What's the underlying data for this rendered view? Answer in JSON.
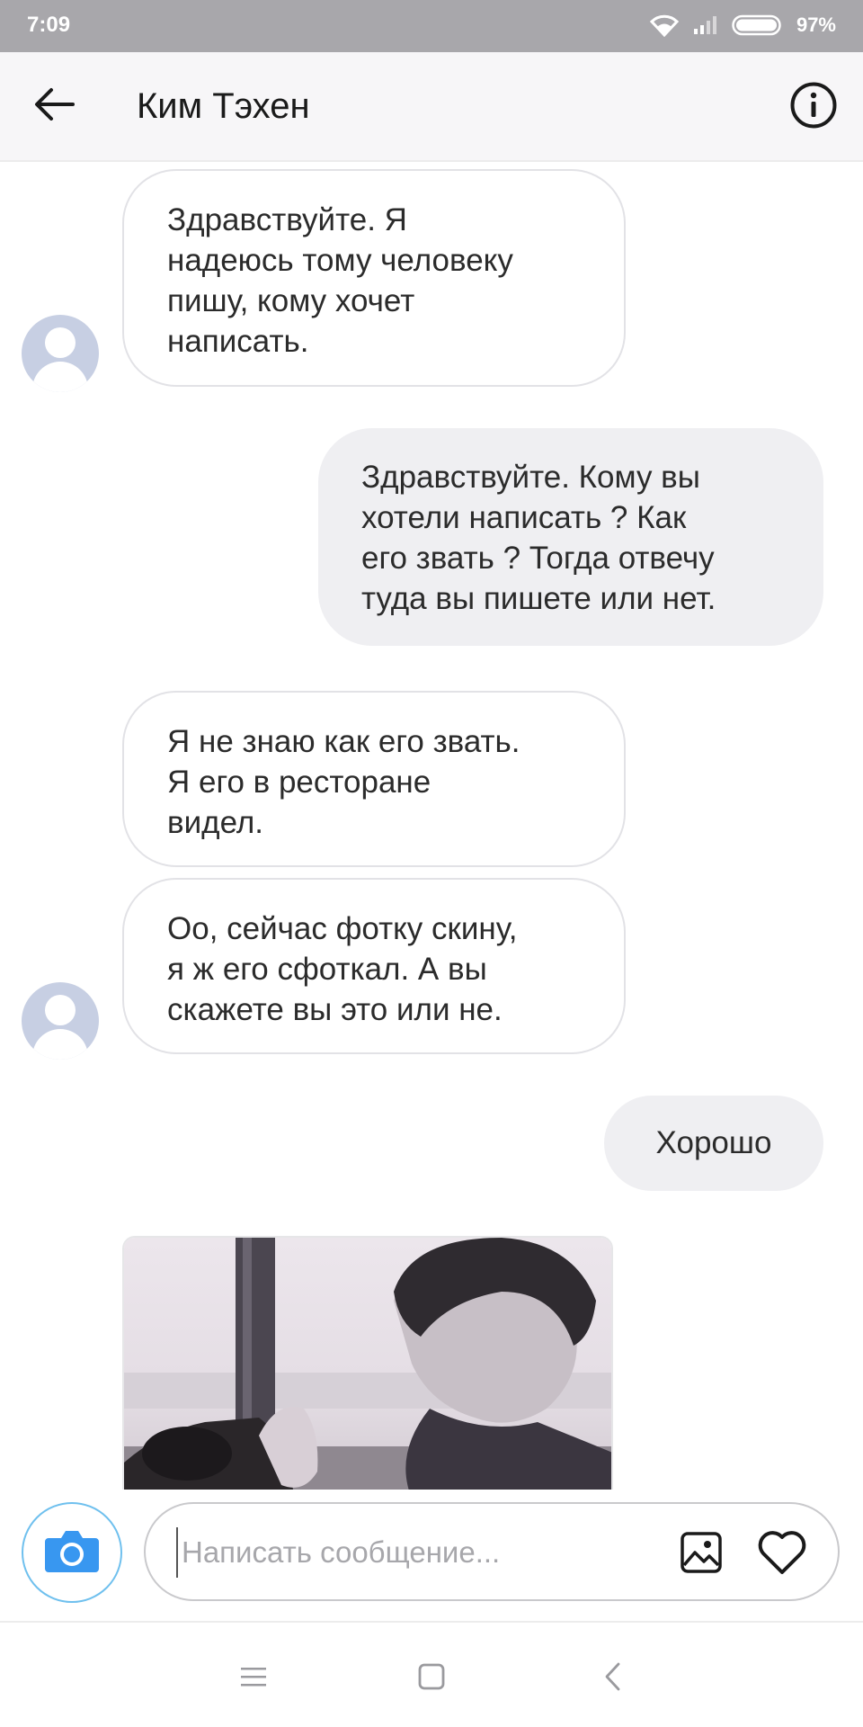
{
  "status_bar": {
    "time": "7:09",
    "battery": "97%",
    "icons": [
      "wifi-icon",
      "signal-icon",
      "battery-icon"
    ]
  },
  "header": {
    "title": "Ким Тэхен",
    "back_icon": "arrow-left-icon",
    "info_icon": "info-icon"
  },
  "messages": [
    {
      "direction": "incoming",
      "lines": [
        "Здравствуйте. Я",
        "надеюсь тому человеку",
        "пишу, кому хочет",
        "написать."
      ]
    },
    {
      "direction": "outgoing",
      "lines": [
        "Здравствуйте. Кому вы",
        "хотели написать ? Как",
        "его звать ? Тогда отвечу",
        "туда вы пишете или нет."
      ]
    },
    {
      "direction": "incoming",
      "lines": [
        "Я не знаю как его звать.",
        "Я его в ресторане",
        "видел."
      ]
    },
    {
      "direction": "incoming",
      "lines": [
        "Оо, сейчас фотку скину,",
        "я ж его сфоткал. А вы",
        "скажете вы это или не."
      ]
    },
    {
      "direction": "outgoing",
      "lines": [
        "Хорошо"
      ]
    },
    {
      "direction": "incoming",
      "type": "photo",
      "description_icon": "photo-attachment"
    }
  ],
  "composer": {
    "placeholder": "Написать сообщение...",
    "camera_icon": "camera-icon",
    "gallery_icon": "image-icon",
    "like_icon": "heart-icon"
  },
  "nav_bar": {
    "icons": [
      "menu-icon",
      "home-square-icon",
      "back-chevron-icon"
    ]
  },
  "colors": {
    "status_bar": "#a8a7ab",
    "header_bg": "#f7f6f8",
    "outgoing_bubble": "#efeff2",
    "incoming_border": "#e2e2e6",
    "camera_accent": "#3897f0",
    "avatar_bg": "#c7cfe3"
  }
}
